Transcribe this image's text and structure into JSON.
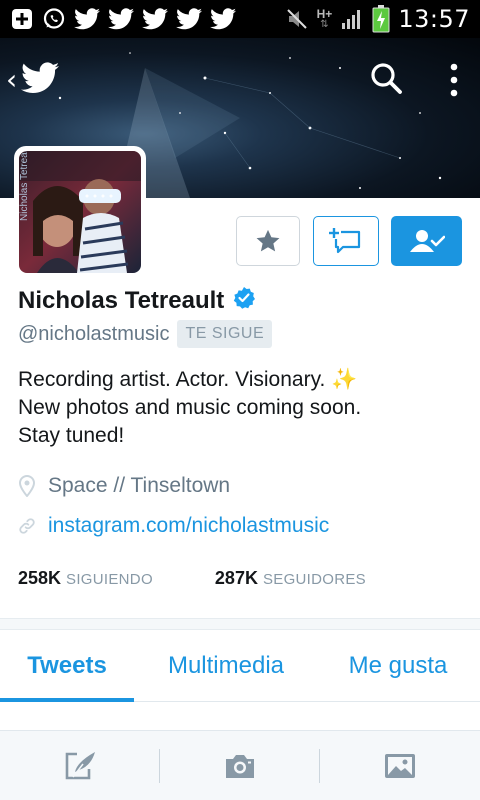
{
  "status_bar": {
    "time": "13:57",
    "network_label": "H+",
    "icons": [
      "add-notification-icon",
      "whatsapp-icon",
      "twitter-notification-icon",
      "twitter-notification-icon",
      "twitter-notification-icon",
      "twitter-notification-icon",
      "twitter-notification-icon",
      "mute-icon",
      "data-arrows-icon",
      "signal-icon",
      "battery-charging-icon"
    ]
  },
  "header": {
    "back_label": "‹",
    "icons": [
      "twitter-bird-icon",
      "search-icon",
      "more-vertical-icon"
    ]
  },
  "actions": {
    "icons": [
      "star-icon",
      "direct-message-icon",
      "following-icon"
    ],
    "follow_state": "following"
  },
  "profile": {
    "name": "Nicholas Tetreault",
    "verified": true,
    "handle": "@nicholastmusic",
    "follows_you_badge": "TE SIGUE",
    "bio_lines": [
      "Recording artist. Actor. Visionary. ✨",
      "New photos and music coming soon.",
      "Stay tuned!"
    ],
    "location": "Space // Tinseltown",
    "website": "instagram.com/nicholastmusic",
    "following_count": "258K",
    "following_label": "SIGUIENDO",
    "followers_count": "287K",
    "followers_label": "SEGUIDORES"
  },
  "tabs": [
    {
      "label": "Tweets",
      "active": true
    },
    {
      "label": "Multimedia",
      "active": false
    },
    {
      "label": "Me gusta",
      "active": false
    }
  ],
  "bottom_bar": {
    "icons": [
      "compose-tweet-icon",
      "camera-icon",
      "gallery-icon"
    ]
  },
  "colors": {
    "accent": "#1b95e0",
    "status_bar": "#000000",
    "secondary_text": "#657786",
    "battery_green": "#5cc93f"
  }
}
